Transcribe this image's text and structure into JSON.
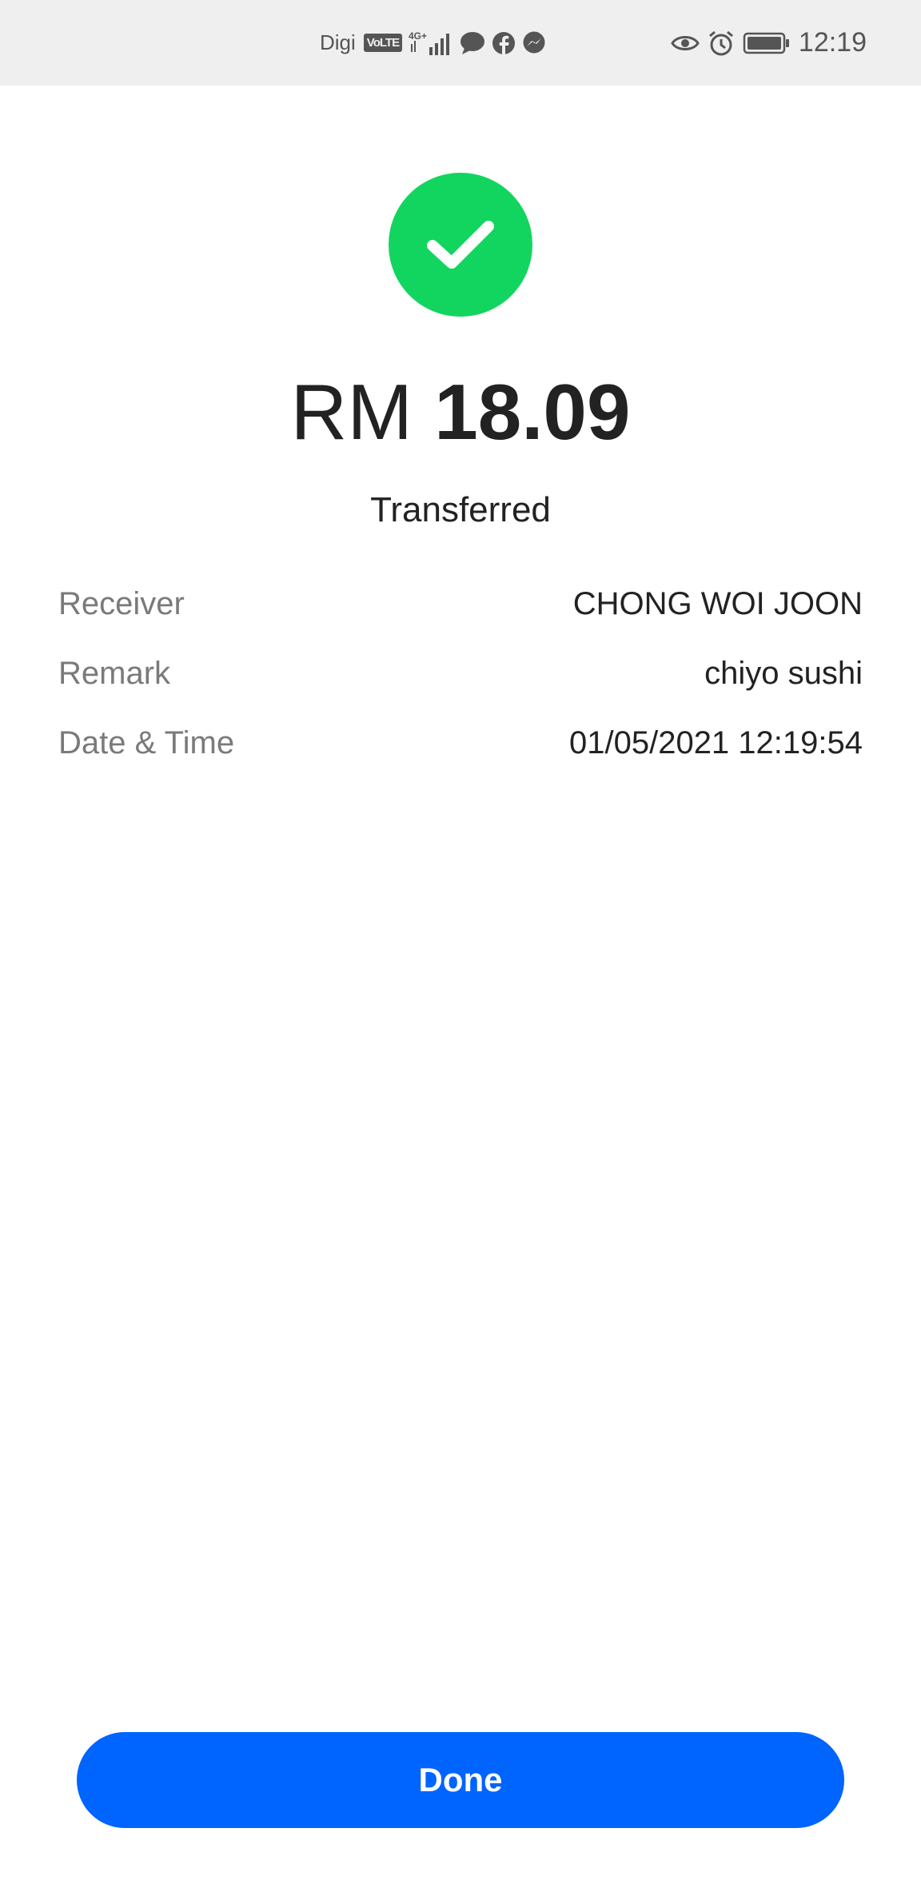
{
  "status_bar": {
    "carrier": "Digi",
    "volte": "VoLTE",
    "network": "4G+",
    "time": "12:19",
    "icons_left": [
      "volte-icon",
      "signal-icon",
      "message-icon",
      "facebook-icon",
      "messenger-icon"
    ],
    "icons_right": [
      "eye-icon",
      "alarm-icon",
      "battery-icon"
    ]
  },
  "receipt": {
    "currency": "RM",
    "amount": "18.09",
    "status": "Transferred",
    "success_color": "#12d55f",
    "details": [
      {
        "label": "Receiver",
        "value": "CHONG WOI JOON"
      },
      {
        "label": "Remark",
        "value": "chiyo sushi"
      },
      {
        "label": "Date & Time",
        "value": "01/05/2021 12:19:54"
      }
    ]
  },
  "actions": {
    "done_label": "Done",
    "button_color": "#0064ff"
  }
}
